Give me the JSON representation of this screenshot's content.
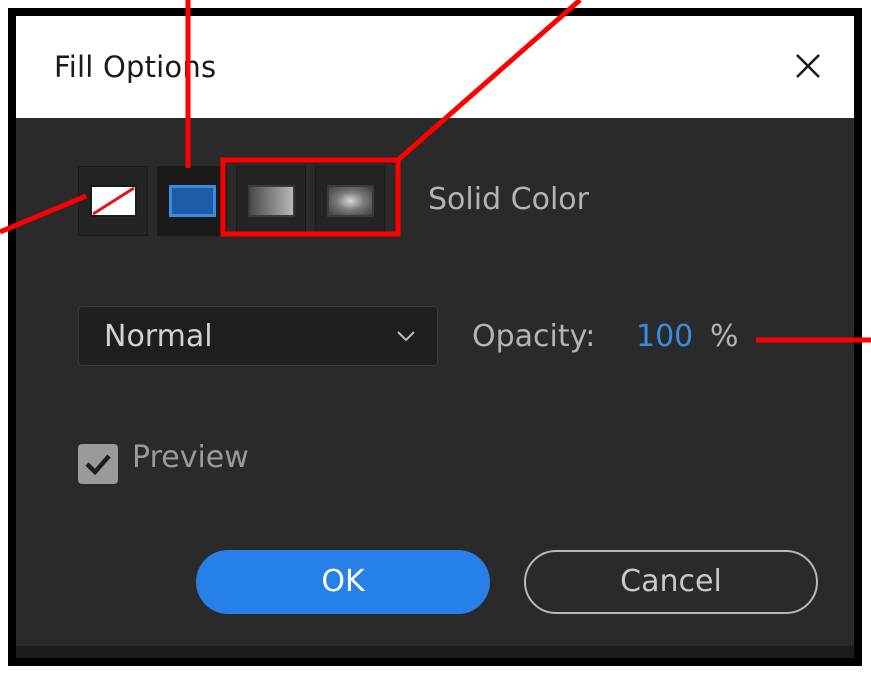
{
  "dialog": {
    "title": "Fill Options",
    "close_icon": "close-icon"
  },
  "fill_types": {
    "items": [
      {
        "id": "none",
        "icon": "no-fill-icon"
      },
      {
        "id": "solid",
        "icon": "solid-color-icon",
        "color": "#1f5ca8"
      },
      {
        "id": "linear",
        "icon": "linear-gradient-icon"
      },
      {
        "id": "radial",
        "icon": "radial-gradient-icon"
      }
    ],
    "selected": "solid",
    "selected_label": "Solid Color"
  },
  "blend": {
    "value": "Normal"
  },
  "opacity": {
    "label": "Opacity:",
    "value": "100",
    "unit": "%"
  },
  "preview": {
    "label": "Preview",
    "checked": true
  },
  "buttons": {
    "ok": "OK",
    "cancel": "Cancel"
  },
  "colors": {
    "accent": "#2680e8",
    "callout": "#ff0000",
    "panel": "#2a2a2a"
  }
}
